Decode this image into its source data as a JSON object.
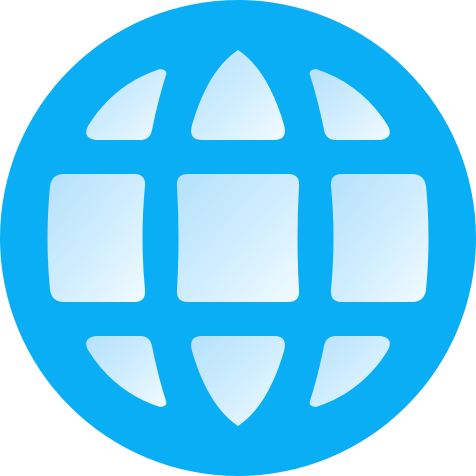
{
  "icon": {
    "name": "globe-icon",
    "colors": {
      "background": "#ffffff",
      "circle": "#0aaef5",
      "panel_light": "#f2fbff",
      "panel_mid": "#d2eeff",
      "panel_dark": "#b4e1fb"
    }
  }
}
